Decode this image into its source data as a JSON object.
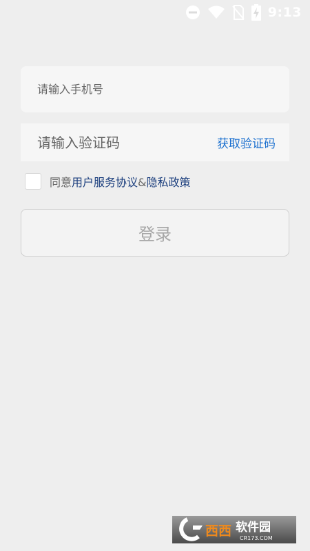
{
  "status_bar": {
    "time": "9:13",
    "icons": [
      "do-not-disturb-icon",
      "wifi-icon",
      "no-sim-icon",
      "battery-charging-icon"
    ]
  },
  "login_form": {
    "phone_placeholder": "请输入手机号",
    "phone_value": "",
    "code_placeholder": "请输入验证码",
    "code_value": "",
    "get_code_label": "获取验证码",
    "agreement": {
      "checked": false,
      "prefix": "同意",
      "terms_link": "用户服务协议",
      "separator": "&",
      "privacy_link": "隐私政策"
    },
    "login_label": "登录"
  },
  "watermark": {
    "brand": "西西软件园",
    "site": "CR173.COM"
  },
  "colors": {
    "background": "#eeeeee",
    "link_blue": "#1a6fcf",
    "agreement_link": "#1c3f7e",
    "button_text_disabled": "#a6a6a6"
  }
}
